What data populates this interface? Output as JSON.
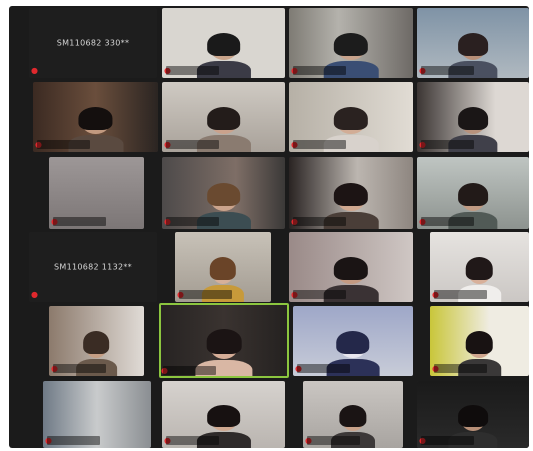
{
  "meeting": {
    "colors": {
      "background": "#1b1b1b",
      "active_speaker_border": "#8cc63f",
      "muted_icon": "#e0282d"
    },
    "participants": [
      {
        "name": "",
        "camera_off": true,
        "display_text": "SM110682 330**"
      },
      {
        "name": "",
        "camera_off": false
      },
      {
        "name": "",
        "camera_off": false
      },
      {
        "name": "",
        "camera_off": false
      },
      {
        "name": "",
        "camera_off": false
      },
      {
        "name": "",
        "camera_off": false
      },
      {
        "name": "",
        "camera_off": false
      },
      {
        "name": "",
        "camera_off": false
      },
      {
        "name": "",
        "camera_off": false
      },
      {
        "name": "",
        "camera_off": false
      },
      {
        "name": "",
        "camera_off": false
      },
      {
        "name": "",
        "camera_off": false
      },
      {
        "name": "",
        "camera_off": true,
        "display_text": "SM110682 1132**"
      },
      {
        "name": "",
        "camera_off": false
      },
      {
        "name": "",
        "camera_off": false
      },
      {
        "name": "",
        "camera_off": false
      },
      {
        "name": "",
        "camera_off": false
      },
      {
        "name": "",
        "camera_off": false,
        "active_speaker": true
      },
      {
        "name": "",
        "camera_off": false
      },
      {
        "name": "",
        "camera_off": false
      },
      {
        "name": "",
        "camera_off": false
      },
      {
        "name": "",
        "camera_off": false
      },
      {
        "name": "",
        "camera_off": false
      },
      {
        "name": "",
        "camera_off": false
      }
    ],
    "muted_icon": "mic-muted-icon"
  }
}
